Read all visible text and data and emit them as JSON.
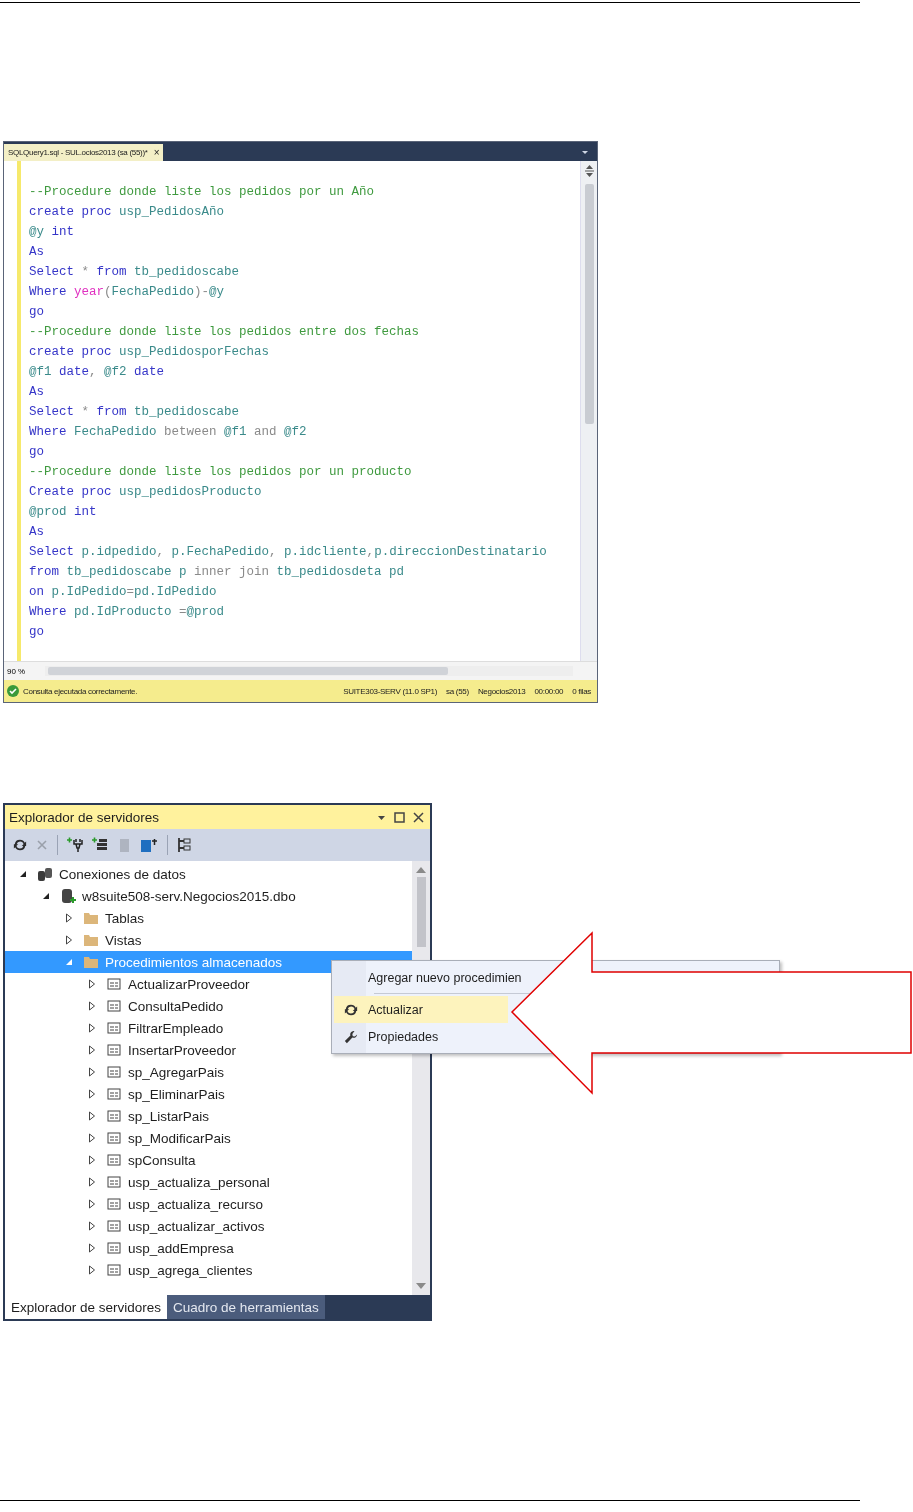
{
  "query_editor": {
    "tab": {
      "title": "SQLQuery1.sql - SUL.ocios2013 (sa (55))*",
      "close": "×"
    },
    "lines": [
      {
        "tokens": [
          {
            "kind": "comment",
            "text": "--Procedure donde liste los pedidos por un Año"
          }
        ]
      },
      {
        "tokens": [
          {
            "kind": "keyword",
            "text": "create proc "
          },
          {
            "kind": "ident",
            "text": "usp_PedidosAño"
          }
        ]
      },
      {
        "tokens": [
          {
            "kind": "ident",
            "text": "@y "
          },
          {
            "kind": "keyword",
            "text": "int"
          }
        ]
      },
      {
        "tokens": [
          {
            "kind": "keyword",
            "text": "As"
          }
        ]
      },
      {
        "tokens": [
          {
            "kind": "keyword",
            "text": "Select "
          },
          {
            "kind": "operator",
            "text": "* "
          },
          {
            "kind": "keyword",
            "text": "from "
          },
          {
            "kind": "ident",
            "text": "tb_pedidoscabe"
          }
        ]
      },
      {
        "tokens": [
          {
            "kind": "keyword",
            "text": "Where "
          },
          {
            "kind": "function",
            "text": "year"
          },
          {
            "kind": "operator",
            "text": "("
          },
          {
            "kind": "ident",
            "text": "FechaPedido"
          },
          {
            "kind": "operator",
            "text": ")-"
          },
          {
            "kind": "ident",
            "text": "@y"
          }
        ]
      },
      {
        "tokens": [
          {
            "kind": "keyword",
            "text": "go"
          }
        ]
      },
      {
        "tokens": [
          {
            "kind": "comment",
            "text": "--Procedure donde liste los pedidos entre dos fechas"
          }
        ]
      },
      {
        "tokens": [
          {
            "kind": "keyword",
            "text": "create proc "
          },
          {
            "kind": "ident",
            "text": "usp_PedidosporFechas"
          }
        ]
      },
      {
        "tokens": [
          {
            "kind": "ident",
            "text": "@f1 "
          },
          {
            "kind": "keyword",
            "text": "date"
          },
          {
            "kind": "operator",
            "text": ", "
          },
          {
            "kind": "ident",
            "text": "@f2 "
          },
          {
            "kind": "keyword",
            "text": "date"
          }
        ]
      },
      {
        "tokens": [
          {
            "kind": "keyword",
            "text": "As"
          }
        ]
      },
      {
        "tokens": [
          {
            "kind": "keyword",
            "text": "Select "
          },
          {
            "kind": "operator",
            "text": "* "
          },
          {
            "kind": "keyword",
            "text": "from "
          },
          {
            "kind": "ident",
            "text": "tb_pedidoscabe"
          }
        ]
      },
      {
        "tokens": [
          {
            "kind": "keyword",
            "text": "Where "
          },
          {
            "kind": "ident",
            "text": "FechaPedido "
          },
          {
            "kind": "operator",
            "text": "between "
          },
          {
            "kind": "ident",
            "text": "@f1 "
          },
          {
            "kind": "operator",
            "text": "and "
          },
          {
            "kind": "ident",
            "text": "@f2"
          }
        ]
      },
      {
        "tokens": [
          {
            "kind": "keyword",
            "text": "go"
          }
        ]
      },
      {
        "tokens": [
          {
            "kind": "comment",
            "text": "--Procedure donde liste los pedidos por un producto"
          }
        ]
      },
      {
        "tokens": [
          {
            "kind": "keyword",
            "text": "Create proc "
          },
          {
            "kind": "ident",
            "text": "usp_pedidosProducto"
          }
        ]
      },
      {
        "tokens": [
          {
            "kind": "ident",
            "text": "@prod "
          },
          {
            "kind": "keyword",
            "text": "int"
          }
        ]
      },
      {
        "tokens": [
          {
            "kind": "keyword",
            "text": "As"
          }
        ]
      },
      {
        "tokens": [
          {
            "kind": "keyword",
            "text": "Select "
          },
          {
            "kind": "ident",
            "text": "p.idpedido"
          },
          {
            "kind": "operator",
            "text": ", "
          },
          {
            "kind": "ident",
            "text": "p.FechaPedido"
          },
          {
            "kind": "operator",
            "text": ", "
          },
          {
            "kind": "ident",
            "text": "p.idcliente"
          },
          {
            "kind": "operator",
            "text": ","
          },
          {
            "kind": "ident",
            "text": "p.direccionDestinatario"
          }
        ]
      },
      {
        "tokens": [
          {
            "kind": "keyword",
            "text": "from "
          },
          {
            "kind": "ident",
            "text": "tb_pedidoscabe p "
          },
          {
            "kind": "operator",
            "text": "inner join "
          },
          {
            "kind": "ident",
            "text": "tb_pedidosdeta pd"
          }
        ]
      },
      {
        "tokens": [
          {
            "kind": "keyword",
            "text": "on "
          },
          {
            "kind": "ident",
            "text": "p.IdPedido"
          },
          {
            "kind": "operator",
            "text": "="
          },
          {
            "kind": "ident",
            "text": "pd.IdPedido"
          }
        ]
      },
      {
        "tokens": [
          {
            "kind": "keyword",
            "text": "Where "
          },
          {
            "kind": "ident",
            "text": "pd.IdProducto "
          },
          {
            "kind": "operator",
            "text": "="
          },
          {
            "kind": "ident",
            "text": "@prod"
          }
        ]
      },
      {
        "tokens": [
          {
            "kind": "keyword",
            "text": "go"
          }
        ]
      }
    ],
    "zoom": "90 %",
    "status_bar": {
      "message": "Consulta ejecutada correctamente.",
      "server": "SUITE303-SERV (11.0 SP1)",
      "user": "sa (55)",
      "database": "Negocios2013",
      "time": "00:00:00",
      "rows": "0 filas"
    }
  },
  "server_explorer": {
    "title": "Explorador de servidores",
    "tree": [
      {
        "label": "Conexiones de datos",
        "kind": "connections",
        "expanded": true,
        "selected": false,
        "children": [
          {
            "label": "w8suite508-serv.Negocios2015.dbo",
            "kind": "database",
            "expanded": true,
            "selected": false,
            "children": [
              {
                "label": "Tablas",
                "kind": "folder",
                "expanded": false,
                "selected": false
              },
              {
                "label": "Vistas",
                "kind": "folder",
                "expanded": false,
                "selected": false
              },
              {
                "label": "Procedimientos almacenados",
                "kind": "folder",
                "expanded": true,
                "selected": true,
                "children": [
                  {
                    "label": "ActualizarProveedor",
                    "kind": "procedure",
                    "expanded": false,
                    "selected": false
                  },
                  {
                    "label": "ConsultaPedido",
                    "kind": "procedure",
                    "expanded": false,
                    "selected": false
                  },
                  {
                    "label": "FiltrarEmpleado",
                    "kind": "procedure",
                    "expanded": false,
                    "selected": false
                  },
                  {
                    "label": "InsertarProveedor",
                    "kind": "procedure",
                    "expanded": false,
                    "selected": false
                  },
                  {
                    "label": "sp_AgregarPais",
                    "kind": "procedure",
                    "expanded": false,
                    "selected": false
                  },
                  {
                    "label": "sp_EliminarPais",
                    "kind": "procedure",
                    "expanded": false,
                    "selected": false
                  },
                  {
                    "label": "sp_ListarPais",
                    "kind": "procedure",
                    "expanded": false,
                    "selected": false
                  },
                  {
                    "label": "sp_ModificarPais",
                    "kind": "procedure",
                    "expanded": false,
                    "selected": false
                  },
                  {
                    "label": "spConsulta",
                    "kind": "procedure",
                    "expanded": false,
                    "selected": false
                  },
                  {
                    "label": "usp_actualiza_personal",
                    "kind": "procedure",
                    "expanded": false,
                    "selected": false
                  },
                  {
                    "label": "usp_actualiza_recurso",
                    "kind": "procedure",
                    "expanded": false,
                    "selected": false
                  },
                  {
                    "label": "usp_actualizar_activos",
                    "kind": "procedure",
                    "expanded": false,
                    "selected": false
                  },
                  {
                    "label": "usp_addEmpresa",
                    "kind": "procedure",
                    "expanded": false,
                    "selected": false
                  },
                  {
                    "label": "usp_agrega_clientes",
                    "kind": "procedure",
                    "expanded": false,
                    "selected": false
                  }
                ]
              }
            ]
          }
        ]
      }
    ],
    "context_menu": {
      "items": [
        {
          "kind": "plain",
          "label": "Agregar nuevo procedimien",
          "selected": false
        },
        {
          "kind": "separator"
        },
        {
          "kind": "refresh",
          "label": "Actualizar",
          "selected": true
        },
        {
          "kind": "wrench",
          "label": "Propiedades",
          "selected": false
        }
      ]
    },
    "bottom_tabs": [
      {
        "label": "Explorador de servidores",
        "selected": true
      },
      {
        "label": "Cuadro de herramientas",
        "selected": false
      }
    ]
  }
}
